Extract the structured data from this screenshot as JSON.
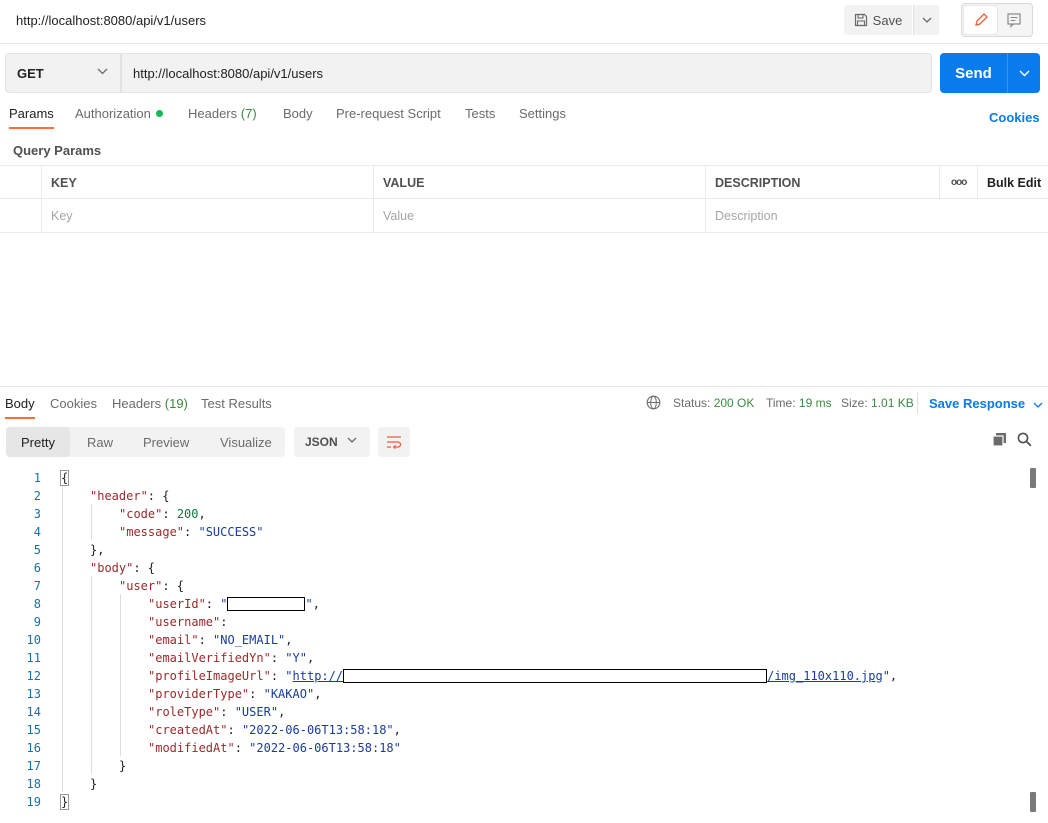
{
  "titlebar": {
    "title": "http://localhost:8080/api/v1/users",
    "save_label": "Save"
  },
  "request": {
    "method": "GET",
    "url": "http://localhost:8080/api/v1/users",
    "send_label": "Send",
    "tabs": [
      "Params",
      "Authorization",
      "Headers",
      "(7)",
      "Body",
      "Pre-request Script",
      "Tests",
      "Settings"
    ],
    "cookies_label": "Cookies"
  },
  "params": {
    "title": "Query Params",
    "headers": [
      "KEY",
      "VALUE",
      "DESCRIPTION",
      "ooo",
      "Bulk Edit"
    ],
    "placeholders": [
      "Key",
      "Value",
      "Description"
    ]
  },
  "response": {
    "tabs": [
      "Body",
      "Cookies",
      "Headers",
      "(19)",
      "Test Results"
    ],
    "status_label": "Status:",
    "status_value": "200 OK",
    "time_label": "Time:",
    "time_value": "19 ms",
    "size_label": "Size:",
    "size_value": "1.01 KB",
    "save_response_label": "Save Response",
    "views": [
      "Pretty",
      "Raw",
      "Preview",
      "Visualize"
    ],
    "format": "JSON"
  },
  "code_lines": [
    "{",
    "\"header\": {",
    "\"code\": 200,",
    "\"message\": \"SUCCESS\"",
    "},",
    "\"body\": {",
    "\"user\": {",
    "\"userId\": \"[redacted]\",",
    "\"username\":",
    "\"email\": \"NO_EMAIL\",",
    "\"emailVerifiedYn\": \"Y\",",
    "\"profileImageUrl\": \"http://[redacted]/img_110x110.jpg\",",
    "\"providerType\": \"KAKAO\",",
    "\"roleType\": \"USER\",",
    "\"createdAt\": \"2022-06-06T13:58:18\",",
    "\"modifiedAt\": \"2022-06-06T13:58:18\"",
    "}",
    "}",
    "}"
  ],
  "code_tokens": {
    "k_header": "\"header\"",
    "k_code": "\"code\"",
    "v_code": "200",
    "k_message": "\"message\"",
    "v_message": "\"SUCCESS\"",
    "k_body": "\"body\"",
    "k_user": "\"user\"",
    "k_userId": "\"userId\"",
    "k_username": "\"username\"",
    "k_email": "\"email\"",
    "v_email": "\"NO_EMAIL\"",
    "k_emailVerifiedYn": "\"emailVerifiedYn\"",
    "v_emailVerifiedYn": "\"Y\"",
    "k_profileImageUrl": "\"profileImageUrl\"",
    "v_url_start": "http://",
    "v_url_end": "/img_110x110.jpg",
    "k_providerType": "\"providerType\"",
    "v_providerType": "\"KAKAO\"",
    "k_roleType": "\"roleType\"",
    "v_roleType": "\"USER\"",
    "k_createdAt": "\"createdAt\"",
    "v_createdAt": "\"2022-06-06T13:58:18\"",
    "k_modifiedAt": "\"modifiedAt\"",
    "v_modifiedAt": "\"2022-06-06T13:58:18\""
  },
  "line_numbers": [
    "1",
    "2",
    "3",
    "4",
    "5",
    "6",
    "7",
    "8",
    "9",
    "10",
    "11",
    "12",
    "13",
    "14",
    "15",
    "16",
    "17",
    "18",
    "19"
  ],
  "icons": {
    "save": "save-icon",
    "edit": "pencil-icon",
    "comments": "comment-icon",
    "globe": "globe-icon",
    "copy": "copy-icon",
    "search": "search-icon",
    "wrap": "wrap-lines-icon"
  },
  "colors": {
    "accent": "#ff6c37",
    "send": "#097bed",
    "status_ok": "#3c8a3e"
  }
}
